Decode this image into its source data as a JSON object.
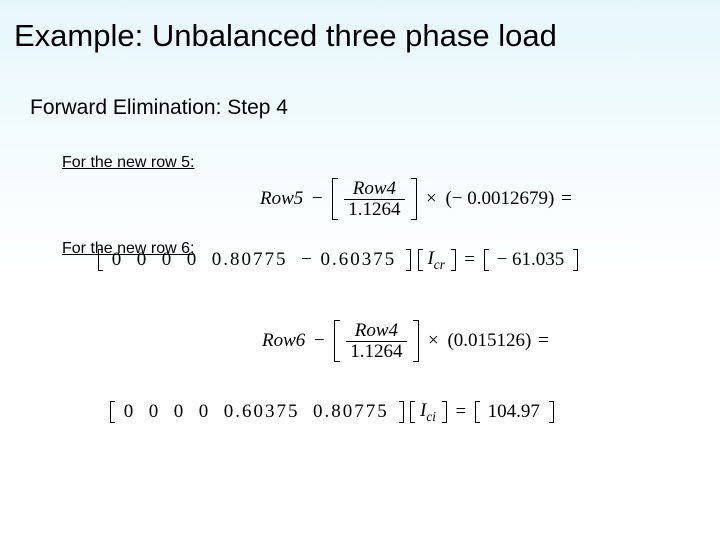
{
  "title": "Example: Unbalanced three phase load",
  "subtitle": "Forward Elimination: Step 4",
  "row5": {
    "label": "For the new row 5:",
    "lhs": "Row5",
    "frac_num": "Row4",
    "frac_den": "1.1264",
    "mult": "− 0.0012679",
    "matrix": [
      "0",
      "0",
      "0",
      "0",
      "0.80775",
      "− 0.60375"
    ],
    "var": "I",
    "var_sub": "cr",
    "rhs": "− 61.035"
  },
  "row6": {
    "label": "For the new row 6:",
    "lhs": "Row6",
    "frac_num": "Row4",
    "frac_den": "1.1264",
    "mult": "0.015126",
    "matrix": [
      "0",
      "0",
      "0",
      "0",
      "0.60375",
      "0.80775"
    ],
    "var": "I",
    "var_sub": "ci",
    "rhs": "104.97"
  }
}
